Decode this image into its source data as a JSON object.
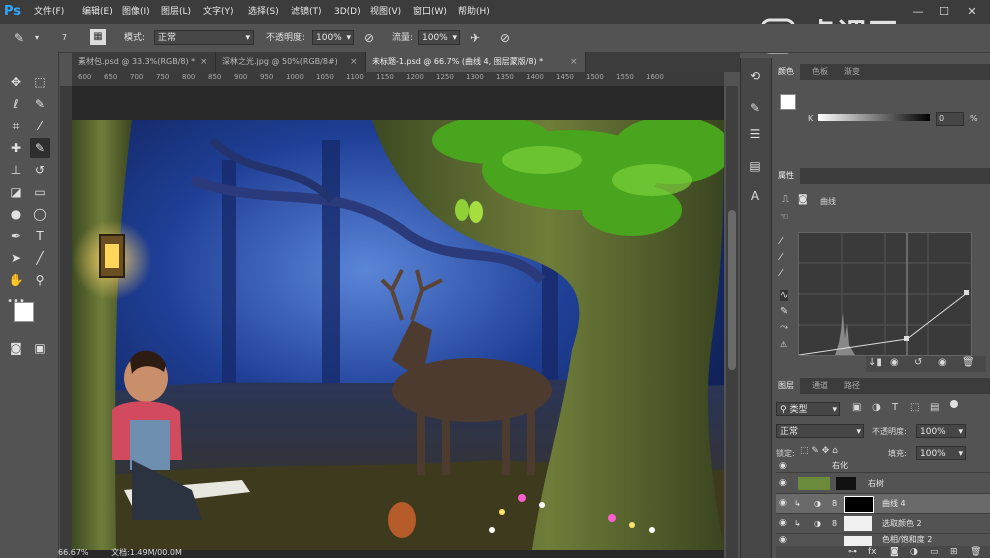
{
  "app": {
    "logo": "Ps"
  },
  "menu": [
    "文件(F)",
    "编辑(E)",
    "图像(I)",
    "图层(L)",
    "文字(Y)",
    "选择(S)",
    "滤镜(T)",
    "3D(D)",
    "视图(V)",
    "窗口(W)",
    "帮助(H)"
  ],
  "window_controls": [
    "—",
    "☐",
    "✕"
  ],
  "options": {
    "brush_size": "7",
    "mode_label": "模式:",
    "mode_value": "正常",
    "opacity_label": "不透明度:",
    "opacity_value": "100%",
    "flow_label": "流量:",
    "flow_value": "100%"
  },
  "tabs": [
    {
      "label": "素材包.psd @ 33.3%(RGB/8) *",
      "close": "×"
    },
    {
      "label": "深林之光.jpg @ 50%(RGB/8#)",
      "close": "×"
    },
    {
      "label": "未标题-1.psd @ 66.7% (曲线 4, 图层蒙版/8) *",
      "close": "×"
    }
  ],
  "ruler_h": [
    "600",
    "650",
    "700",
    "750",
    "800",
    "850",
    "900",
    "950",
    "1000",
    "1050",
    "1100",
    "1150",
    "1200",
    "1250",
    "1300",
    "1350",
    "1400",
    "1450",
    "1500",
    "1550",
    "1600"
  ],
  "status": {
    "zoom": "66.67%",
    "doc": "文档:1.49M/00.0M"
  },
  "watermark": "虎课网",
  "color_panel": {
    "tabs": [
      "颜色",
      "色板",
      "渐变"
    ],
    "k_label": "K",
    "k_value": "0",
    "unit": "%"
  },
  "properties_panel": {
    "tab": "属性",
    "title": "曲线"
  },
  "layers_panel": {
    "tabs": [
      "图层",
      "通道",
      "路径"
    ],
    "kind_label": "类型",
    "blend_mode": "正常",
    "opacity_label": "不透明度:",
    "opacity_value": "100%",
    "lock_label": "锁定:",
    "fill_label": "填充:",
    "fill_value": "100%",
    "layers": [
      {
        "name": "右化"
      },
      {
        "name": "右树"
      },
      {
        "name": "曲线 4"
      },
      {
        "name": "选取颜色 2"
      },
      {
        "name": "色相/饱和度 2"
      }
    ]
  },
  "colors": {
    "menubar": "#3c3c3c",
    "panel": "#535353",
    "ps_blue": "#31a8ff"
  }
}
